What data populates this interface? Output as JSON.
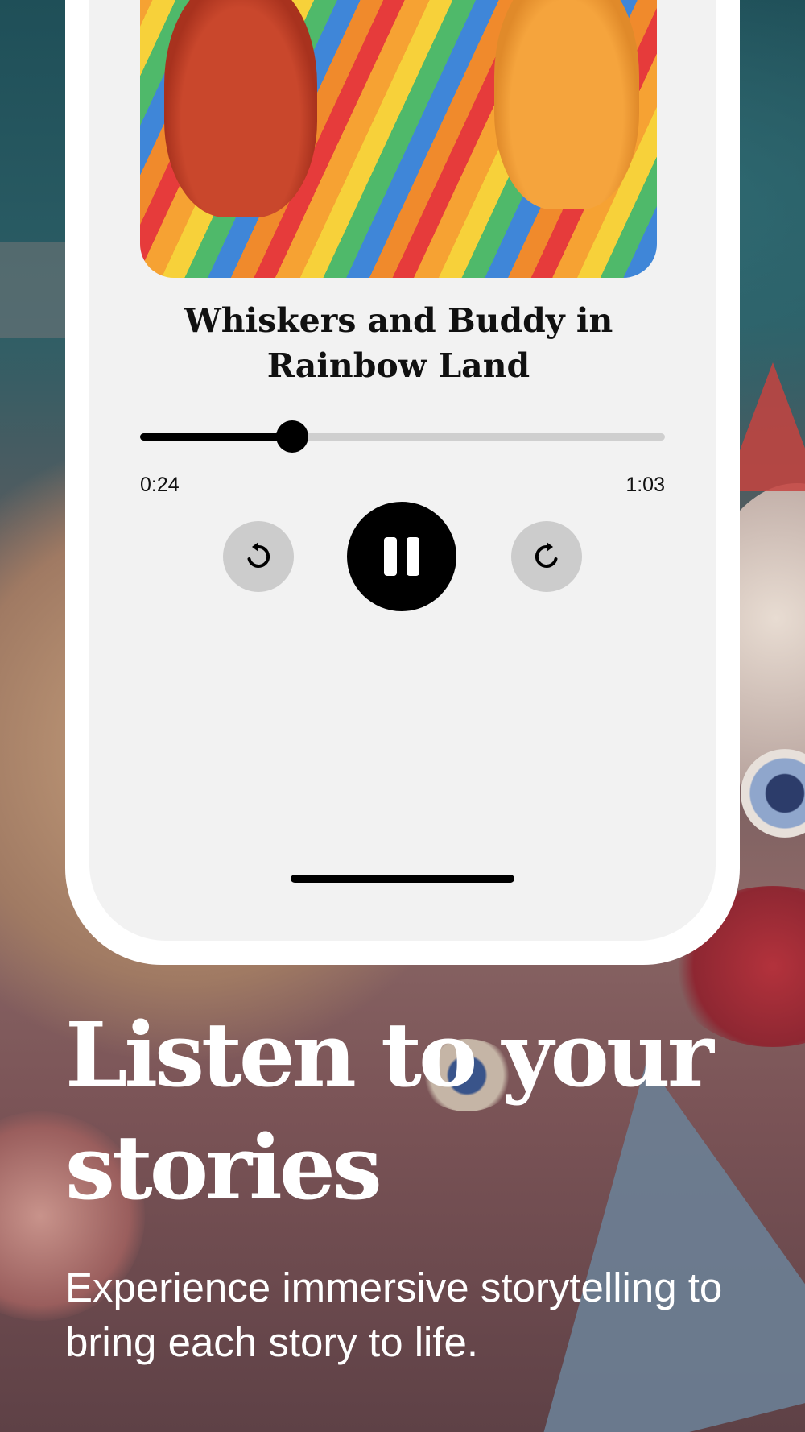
{
  "story": {
    "title": "Whiskers and Buddy in Rainbow Land",
    "cover_art": "whiskers-and-buddy-illustration"
  },
  "player": {
    "elapsed": "0:24",
    "duration": "1:03",
    "progress": 0.2903,
    "state": "playing",
    "rewind_icon": "rewind-icon",
    "pause_icon": "pause-icon",
    "forward_icon": "forward-icon"
  },
  "promo": {
    "headline": "Listen to your stories",
    "subtitle": "Experience immersive storytelling to bring each story to life."
  },
  "colors": {
    "accent": "#000000",
    "screen_background": "#f2f2f2",
    "skip_button": "#cccccc",
    "track": "#cfcfcf"
  }
}
